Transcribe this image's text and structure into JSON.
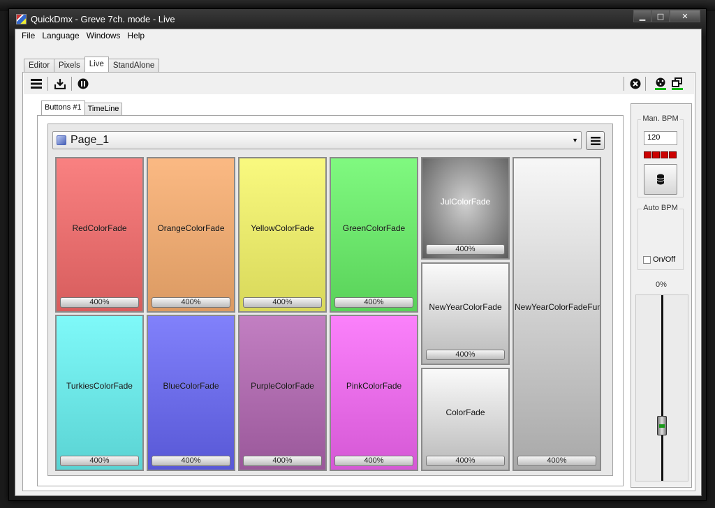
{
  "window": {
    "title": "QuickDmx - Greve 7ch. mode - Live"
  },
  "menu": [
    "File",
    "Language",
    "Windows",
    "Help"
  ],
  "main_tabs": [
    {
      "label": "Editor",
      "active": false
    },
    {
      "label": "Pixels",
      "active": false
    },
    {
      "label": "Live",
      "active": true
    },
    {
      "label": "StandAlone",
      "active": false
    }
  ],
  "toolbar": {
    "left_icons": [
      "menu-icon",
      "download-icon",
      "pause-icon"
    ],
    "right_icons": [
      "close-circle-icon",
      "dmx-output-icon",
      "windows-icon"
    ]
  },
  "sub_tabs": [
    {
      "label": "Buttons #1",
      "active": true
    },
    {
      "label": "TimeLine",
      "active": false
    }
  ],
  "page": {
    "selected": "Page_1"
  },
  "scenes": [
    {
      "name": "RedColorFade",
      "percent": "400%",
      "color_top": "#f98181",
      "color_bottom": "#d75d5d"
    },
    {
      "name": "OrangeColorFade",
      "percent": "400%",
      "color_top": "#fbb983",
      "color_bottom": "#db9a62"
    },
    {
      "name": "YellowColorFade",
      "percent": "400%",
      "color_top": "#f9f97f",
      "color_bottom": "#d8d85a"
    },
    {
      "name": "GreenColorFade",
      "percent": "400%",
      "color_top": "#80f980",
      "color_bottom": "#59d259"
    },
    {
      "name": "JulColorFade",
      "percent": "400%",
      "color_top": "#d0d0d0",
      "color_bottom": "#5c5c5c"
    },
    {
      "name": "NewYearColorFadeFun",
      "percent": "400%",
      "color_top": "#f7f7f7",
      "color_bottom": "#a8a8a8"
    },
    {
      "name": "TurkiesColorFade",
      "percent": "400%",
      "color_top": "#7ff9f9",
      "color_bottom": "#5ad3d3"
    },
    {
      "name": "BlueColorFade",
      "percent": "400%",
      "color_top": "#8181fb",
      "color_bottom": "#5858d6"
    },
    {
      "name": "PurpleColorFade",
      "percent": "400%",
      "color_top": "#c27fc2",
      "color_bottom": "#9a589a"
    },
    {
      "name": "PinkColorFade",
      "percent": "400%",
      "color_top": "#fb81fb",
      "color_bottom": "#d558d5"
    },
    {
      "name": "NewYearColorFade",
      "percent": "400%",
      "color_top": "#fafafa",
      "color_bottom": "#b8b8b8"
    },
    {
      "name": "ColorFade",
      "percent": "400%",
      "color_top": "#fafafa",
      "color_bottom": "#b8b8b8"
    }
  ],
  "bpm": {
    "manual_label": "Man. BPM",
    "manual_value": "120",
    "auto_label": "Auto BPM",
    "onoff_label": "On/Off",
    "onoff_checked": false,
    "level_label": "0%",
    "level": 0.2
  }
}
